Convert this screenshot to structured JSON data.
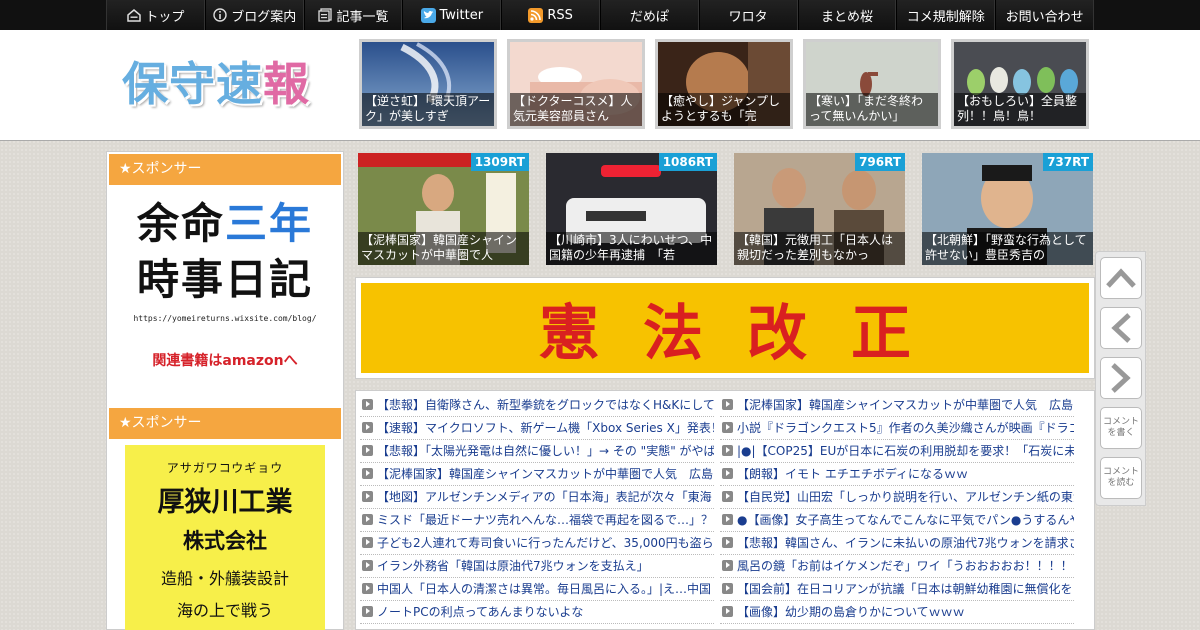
{
  "nav": {
    "items": [
      {
        "label": "トップ",
        "icon": "home-icon"
      },
      {
        "label": "ブログ案内",
        "icon": "info-icon"
      },
      {
        "label": "記事一覧",
        "icon": "list-icon"
      },
      {
        "label": "Twitter",
        "icon": "twitter-icon"
      },
      {
        "label": "RSS",
        "icon": "rss-icon"
      },
      {
        "label": "だめぽ"
      },
      {
        "label": "ワロタ"
      },
      {
        "label": "まとめ桜"
      },
      {
        "label": "コメ規制解除"
      },
      {
        "label": "お問い合わせ"
      }
    ]
  },
  "header": {
    "logo_blue": "保守速",
    "logo_pink": "報"
  },
  "top_thumbs": [
    {
      "caption": "【逆さ虹】「環天頂アーク」が美しすぎ"
    },
    {
      "caption": "【ドクターコスメ】人気元美容部員さん"
    },
    {
      "caption": "【癒やし】ジャンプしようとするも「完"
    },
    {
      "caption": "【寒い】「まだ冬終わって無いんかい」"
    },
    {
      "caption": "【おもしろい】全員整列！！鳥！鳥！"
    }
  ],
  "sidebar": {
    "sponsor1": "★スポンサー",
    "sponsor2": "★スポンサー",
    "ad1": {
      "line1_a": "余命",
      "line1_b": "三年",
      "line2": "時事日記",
      "url": "https://yomeireturns.wixsite.com/blog/",
      "amazon": "関連書籍はamazonへ"
    },
    "ad2": {
      "kana": "アサガワコウギョウ",
      "name1": "厚狭川工業",
      "name2": "株式会社",
      "line3": "造船・外艤装設計",
      "line4": "海の上で戦う"
    }
  },
  "rt_cards": [
    {
      "rt": "1309RT",
      "caption": "【泥棒国家】韓国産シャインマスカットが中華圏で人"
    },
    {
      "rt": "1086RT",
      "caption": "【川崎市】3人にわいせつ、中国籍の少年再逮捕　「若"
    },
    {
      "rt": "796RT",
      "caption": "【韓国】元徴用工「日本人は親切だった差別もなかっ"
    },
    {
      "rt": "737RT",
      "caption": "【北朝鮮】「野蛮な行為として許せない」豊臣秀吉の"
    }
  ],
  "banner": {
    "text": "憲法改正"
  },
  "articles_left": [
    "【悲報】自衛隊さん、新型拳銃をグロックではなくH&Kにして",
    "【速報】マイクロソフト、新ゲーム機「Xbox Series X」発表！",
    "【悲報】「太陽光発電は自然に優しい！」→ その \"実態\" がやば",
    "【泥棒国家】韓国産シャインマスカットが中華圏で人気　広島",
    "【地図】アルゼンチンメディアの「日本海」表記が次々「東海",
    "ミスド「最近ドーナツ売れへんな…福袋で再起を図るで…」？",
    "子ども2人連れて寿司食いに行ったんだけど、35,000円も盗られ",
    "イラン外務省「韓国は原油代7兆ウォンを支払え」",
    "中国人「日本人の清潔さは異常。毎日風呂に入る。」|え…中国",
    "ノートPCの利点ってあんまりないよな"
  ],
  "articles_right": [
    "【泥棒国家】韓国産シャインマスカットが中華圏で人気　広島",
    "小説『ドラゴンクエスト5』作者の久美沙織さんが映画『ドラゴ",
    "|●|【COP25】EUが日本に石炭の利用脱却を要求！「石炭に未来",
    "【朗報】イモト エチエチボディになるｗｗ",
    "【自民党】山田宏「しっかり説明を行い、アルゼンチン紙の東海",
    "●【画像】女子高生ってなんでこんなに平気でパン●うするんや",
    "【悲報】韓国さん、イランに未払いの原油代7兆ウォンを請求され",
    "風呂の鏡「お前はイケメンだぞ」ワイ「うおおおおお！！！！",
    "【国会前】在日コリアンが抗議「日本は朝鮮幼稚園に無償化を",
    "【画像】幼少期の島倉りかについてｗｗｗ"
  ],
  "float_buttons": {
    "comment_write": "コメントを書く",
    "comment_read": "コメントを読む"
  }
}
